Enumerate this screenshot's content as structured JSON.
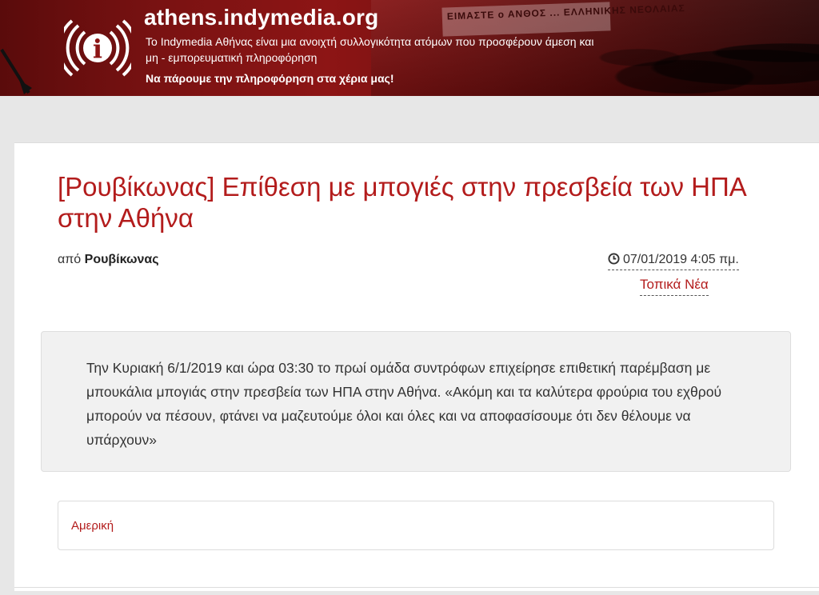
{
  "header": {
    "site_title": "athens.indymedia.org",
    "tagline": "Το Indymedia Αθήνας είναι μια ανοιχτή συλλογικότητα ατόμων που προσφέρουν άμεση και μη - εμπορευματική πληροφόρηση",
    "slogan": "Να πάρουμε την πληροφόρηση στα χέρια μας!",
    "banner_sign_text": "ΕΙΜΑΣΤΕ ο ΑΝΘΟΣ ... ΕΛΛΗΝΙΚΗΣ ΝΕΟΛΑΙΑΣ",
    "logo_icon": "indymedia-broadcast-i-icon",
    "brand_color": "#8d1515"
  },
  "article": {
    "title": "[Ρουβίκωνας] Επίθεση με μπογιές στην πρεσβεία των ΗΠΑ στην Αθήνα",
    "author_prefix": "από",
    "author": "Ρουβίκωνας",
    "date": "07/01/2019 4:05 πμ.",
    "date_icon": "clock-icon",
    "category": "Τοπικά Νέα",
    "summary": "Την Κυριακή 6/1/2019 και ώρα 03:30 το πρωί ομάδα συντρόφων επιχείρησε επιθετική παρέμβαση με μπουκάλια μπογιάς στην πρεσβεία των ΗΠΑ στην Αθήνα. «Ακόμη και τα καλύτερα φρούρια του εχθρού μπορούν να πέσουν, φτάνει να μαζευτούμε όλοι και όλες και να αποφασίσουμε ότι δεν θέλουμε να υπάρχουν»",
    "tags": [
      "Αμερική"
    ],
    "accent_color": "#b31c1c"
  }
}
